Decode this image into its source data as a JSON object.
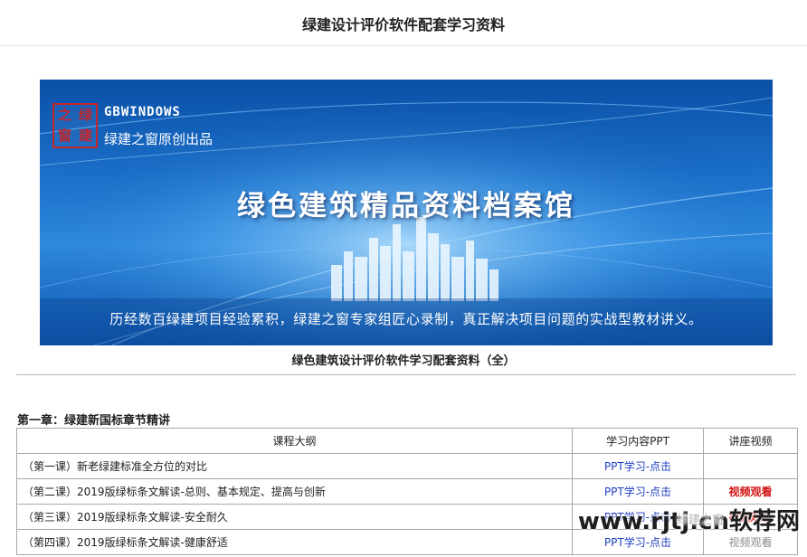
{
  "page": {
    "title": "绿建设计评价软件配套学习资料"
  },
  "banner": {
    "seal_chars": [
      "绿",
      "之",
      "建",
      "窗"
    ],
    "brand_name": "GBWINDOWS",
    "brand_tagline": "绿建之窗原创出品",
    "headline": "绿色建筑精品资料档案馆",
    "slogan": "历经数百绿建项目经验累积，绿建之窗专家组匠心录制，真正解决项目问题的实战型教材讲义。"
  },
  "collection": {
    "title": "绿色建筑设计评价软件学习配套资料（全）"
  },
  "chapter": {
    "heading": "第一章：绿建新国标章节精讲",
    "columns": {
      "outline": "课程大纲",
      "ppt": "学习内容PPT",
      "video": "讲座视频"
    },
    "rows": [
      {
        "outline": "（第一课）新老绿建标准全方位的对比",
        "ppt": "PPT学习-点击",
        "video": ""
      },
      {
        "outline": "（第二课）2019版绿标条文解读-总则、基本规定、提高与创新",
        "ppt": "PPT学习-点击",
        "video": "视频观看"
      },
      {
        "outline": "（第三课）2019版绿标条文解读-安全耐久",
        "ppt": "PPT学习-点击",
        "video": "视频观看"
      },
      {
        "outline": "（第四课）2019版绿标条文解读-健康舒适",
        "ppt": "PPT学习-点击",
        "video": "视频观看"
      }
    ]
  },
  "watermark": {
    "text": "www.rjtj.cn软荐网",
    "ghost_text": "绿建之窗"
  },
  "colors": {
    "link_blue": "#1d3fbf",
    "video_red": "#d20f0f",
    "banner_blue": "#1a6fc9",
    "seal_red": "#c2262b"
  }
}
